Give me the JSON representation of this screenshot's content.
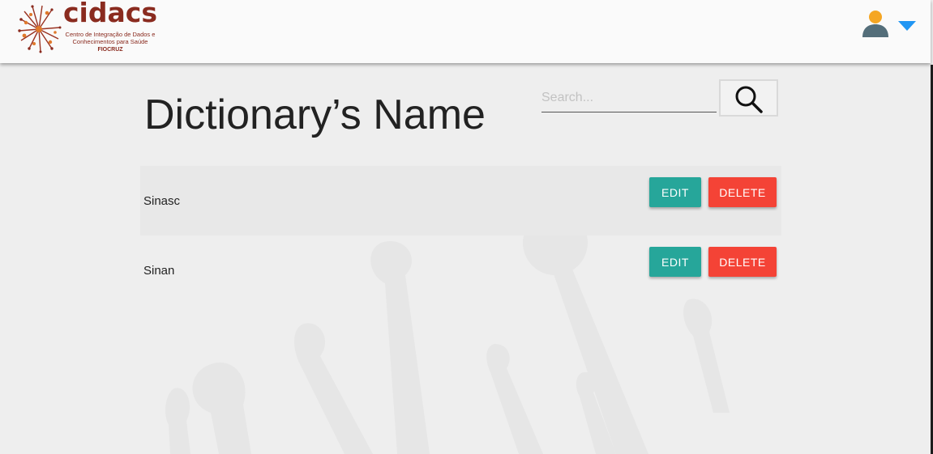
{
  "header": {
    "logo": {
      "name": "cidacs",
      "subtitle": "Centro de Integração de Dados e Conhecimentos para Saúde",
      "org": "FIOCRUZ",
      "brand_color": "#8a2b1f"
    },
    "user_menu": {
      "avatar_icon": "person-icon",
      "dropdown_icon": "triangle-down-icon",
      "avatar_head_color": "#f5a623",
      "avatar_body_color": "#546e7a",
      "dropdown_color": "#2196f3"
    }
  },
  "main": {
    "title": "Dictionary’s Name",
    "search": {
      "placeholder": "Search...",
      "value": "",
      "button_icon": "search-icon"
    },
    "rows": [
      {
        "label": "Sinasc",
        "edit_label": "EDIT",
        "delete_label": "DELETE"
      },
      {
        "label": "Sinan",
        "edit_label": "EDIT",
        "delete_label": "DELETE"
      }
    ]
  },
  "colors": {
    "edit": "#26a69a",
    "delete": "#f44336",
    "background": "#eeeeee"
  }
}
